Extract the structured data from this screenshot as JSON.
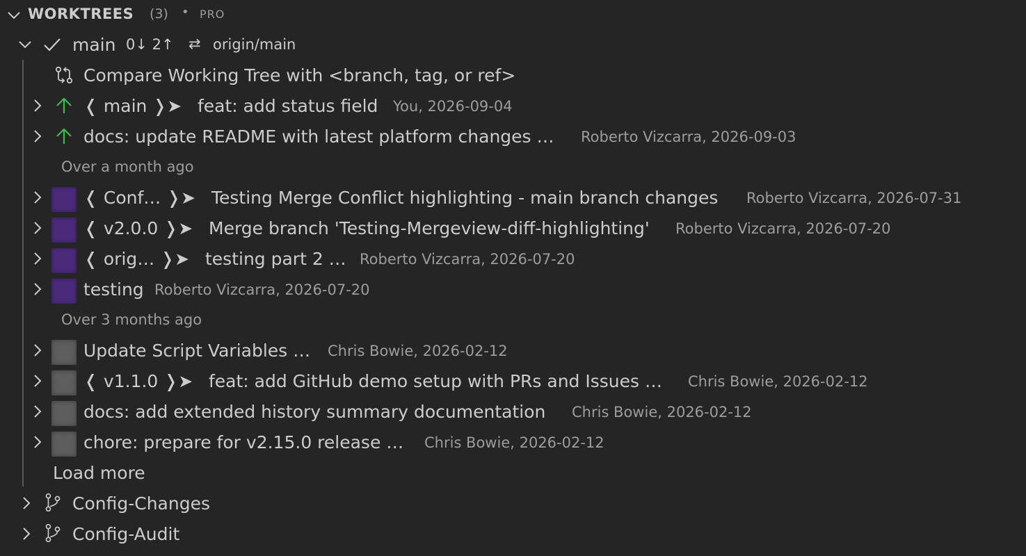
{
  "header": {
    "title": "WORKTREES",
    "count": "(3)",
    "separator": "•",
    "badge": "PRO"
  },
  "main_worktree": {
    "name": "main",
    "sync": "0↓ 2↑",
    "tracking_icon": "⇄",
    "upstream": "origin/main",
    "compare_label": "Compare Working Tree with <branch, tag, or ref>",
    "commits": [
      {
        "refs": "❬ main ❭➤",
        "message": "feat: add status field",
        "meta": "You, 2026-09-04",
        "status": "ahead"
      },
      {
        "refs": "",
        "message": "docs: update README with latest platform changes …",
        "meta": "Roberto Vizcarra, 2026-09-03",
        "status": "ahead"
      }
    ],
    "group_month": "Over a month ago",
    "commits_month": [
      {
        "refs": "❬ Conf… ❭➤",
        "message": "Testing Merge Conflict highlighting - main branch changes",
        "meta": "Roberto Vizcarra, 2026-07-31"
      },
      {
        "refs": "❬ v2.0.0 ❭➤",
        "message": "Merge branch 'Testing-Mergeview-diff-highlighting'",
        "meta": "Roberto Vizcarra, 2026-07-20"
      },
      {
        "refs": "❬ orig… ❭➤",
        "message": "testing part 2 …",
        "meta": "Roberto Vizcarra, 2026-07-20"
      },
      {
        "refs": "",
        "message": "testing",
        "meta": "Roberto Vizcarra, 2026-07-20"
      }
    ],
    "group_3months": "Over 3 months ago",
    "commits_3months": [
      {
        "refs": "",
        "message": "Update Script Variables …",
        "meta": "Chris Bowie, 2026-02-12"
      },
      {
        "refs": "❬ v1.1.0 ❭➤",
        "message": "feat: add GitHub demo setup with PRs and Issues …",
        "meta": "Chris Bowie, 2026-02-12"
      },
      {
        "refs": "",
        "message": "docs: add extended history summary documentation",
        "meta": "Chris Bowie, 2026-02-12"
      },
      {
        "refs": "",
        "message": "chore: prepare for v2.15.0 release …",
        "meta": "Chris Bowie, 2026-02-12"
      }
    ],
    "load_more": "Load more"
  },
  "other_worktrees": [
    {
      "name": "Config-Changes"
    },
    {
      "name": "Config-Audit"
    }
  ],
  "colors": {
    "background": "#252526",
    "text": "#cccccc",
    "dim_text": "#9d9d9d",
    "ahead_arrow": "#3fb950",
    "avatar_purple": "#4a2a7a",
    "avatar_gray": "#5e5e5e"
  }
}
